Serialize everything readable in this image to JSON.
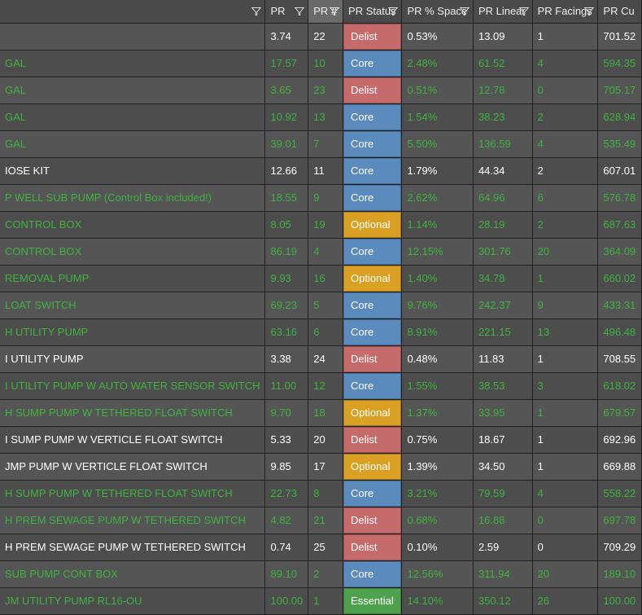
{
  "columns": [
    {
      "key": "name",
      "label": "",
      "width": "c0",
      "filter": true,
      "sorted": false
    },
    {
      "key": "pr",
      "label": "PR",
      "width": "c1",
      "filter": true,
      "sorted": false
    },
    {
      "key": "prnum",
      "label": "PR #",
      "width": "c2",
      "filter": true,
      "sorted": true
    },
    {
      "key": "status",
      "label": "PR Status",
      "width": "c3",
      "filter": true,
      "sorted": false
    },
    {
      "key": "pct",
      "label": "PR % Space",
      "width": "c4",
      "filter": true,
      "sorted": false
    },
    {
      "key": "linear",
      "label": "PR Linear",
      "width": "c5",
      "filter": true,
      "sorted": false
    },
    {
      "key": "facings",
      "label": "PR Facings",
      "width": "c6",
      "filter": true,
      "sorted": false
    },
    {
      "key": "cu",
      "label": "PR Cu",
      "width": "c7",
      "filter": false,
      "sorted": false
    }
  ],
  "status_colors": {
    "Delist": "#c66b6b",
    "Core": "#5b8bbd",
    "Optional": "#d9a023",
    "Essential": "#4ea24e"
  },
  "rows": [
    {
      "name": "",
      "pr": "3.74",
      "prnum": "22",
      "status": "Delist",
      "pct": "0.53%",
      "linear": "13.09",
      "facings": "1",
      "cu": "701.52",
      "cls": "white"
    },
    {
      "name": " GAL",
      "pr": "17.57",
      "prnum": "10",
      "status": "Core",
      "pct": "2.48%",
      "linear": "61.52",
      "facings": "4",
      "cu": "594.35",
      "cls": "green"
    },
    {
      "name": "GAL",
      "pr": "3.65",
      "prnum": "23",
      "status": "Delist",
      "pct": "0.51%",
      "linear": "12.78",
      "facings": "0",
      "cu": "705.17",
      "cls": "green"
    },
    {
      "name": "GAL",
      "pr": "10.92",
      "prnum": "13",
      "status": "Core",
      "pct": "1.54%",
      "linear": "38.23",
      "facings": "2",
      "cu": "628.94",
      "cls": "green"
    },
    {
      "name": "GAL",
      "pr": "39.01",
      "prnum": "7",
      "status": "Core",
      "pct": "5.50%",
      "linear": "136.59",
      "facings": "4",
      "cu": "535.49",
      "cls": "green"
    },
    {
      "name": "IOSE KIT",
      "pr": "12.66",
      "prnum": "11",
      "status": "Core",
      "pct": "1.79%",
      "linear": "44.34",
      "facings": "2",
      "cu": "607.01",
      "cls": "white"
    },
    {
      "name": "P WELL SUB PUMP  (Control Box included!)",
      "pr": "18.55",
      "prnum": "9",
      "status": "Core",
      "pct": "2.62%",
      "linear": "64.96",
      "facings": "6",
      "cu": "576.78",
      "cls": "green"
    },
    {
      "name": "CONTROL BOX",
      "pr": "8.05",
      "prnum": "19",
      "status": "Optional",
      "pct": "1.14%",
      "linear": "28.19",
      "facings": "2",
      "cu": "687.63",
      "cls": "green"
    },
    {
      "name": "CONTROL BOX",
      "pr": "86.19",
      "prnum": "4",
      "status": "Core",
      "pct": "12.15%",
      "linear": "301.76",
      "facings": "20",
      "cu": "364.09",
      "cls": "green"
    },
    {
      "name": "REMOVAL PUMP",
      "pr": "9.93",
      "prnum": "16",
      "status": "Optional",
      "pct": "1.40%",
      "linear": "34.78",
      "facings": "1",
      "cu": "660.02",
      "cls": "green"
    },
    {
      "name": "LOAT SWITCH",
      "pr": "69.23",
      "prnum": "5",
      "status": "Core",
      "pct": "9.76%",
      "linear": "242.37",
      "facings": "9",
      "cu": "433.31",
      "cls": "green"
    },
    {
      "name": "H UTILITY PUMP",
      "pr": "63.16",
      "prnum": "6",
      "status": "Core",
      "pct": "8.91%",
      "linear": "221.15",
      "facings": "13",
      "cu": "496.48",
      "cls": "green"
    },
    {
      "name": "I UTILITY PUMP",
      "pr": "3.38",
      "prnum": "24",
      "status": "Delist",
      "pct": "0.48%",
      "linear": "11.83",
      "facings": "1",
      "cu": "708.55",
      "cls": "white"
    },
    {
      "name": "I UTILITY PUMP W AUTO WATER SENSOR SWITCH",
      "pr": "11.00",
      "prnum": "12",
      "status": "Core",
      "pct": "1.55%",
      "linear": "38.53",
      "facings": "3",
      "cu": "618.02",
      "cls": "green"
    },
    {
      "name": "H SUMP PUMP W TETHERED FLOAT SWITCH",
      "pr": "9.70",
      "prnum": "18",
      "status": "Optional",
      "pct": "1.37%",
      "linear": "33.95",
      "facings": "1",
      "cu": "679.57",
      "cls": "green"
    },
    {
      "name": "I SUMP PUMP W VERTICLE FLOAT SWITCH",
      "pr": "5.33",
      "prnum": "20",
      "status": "Delist",
      "pct": "0.75%",
      "linear": "18.67",
      "facings": "1",
      "cu": "692.96",
      "cls": "white"
    },
    {
      "name": "JMP PUMP W VERTICLE FLOAT SWITCH",
      "pr": "9.85",
      "prnum": "17",
      "status": "Optional",
      "pct": "1.39%",
      "linear": "34.50",
      "facings": "1",
      "cu": "669.88",
      "cls": "white"
    },
    {
      "name": "H SUMP PUMP W TETHERED FLOAT SWITCH",
      "pr": "22.73",
      "prnum": "8",
      "status": "Core",
      "pct": "3.21%",
      "linear": "79.59",
      "facings": "4",
      "cu": "558.22",
      "cls": "green"
    },
    {
      "name": "H PREM SEWAGE PUMP W TETHERED SWITCH",
      "pr": "4.82",
      "prnum": "21",
      "status": "Delist",
      "pct": "0.68%",
      "linear": "16.88",
      "facings": "0",
      "cu": "697.78",
      "cls": "green"
    },
    {
      "name": "H PREM SEWAGE PUMP W TETHERED SWITCH",
      "pr": "0.74",
      "prnum": "25",
      "status": "Delist",
      "pct": "0.10%",
      "linear": "2.59",
      "facings": "0",
      "cu": "709.29",
      "cls": "white"
    },
    {
      "name": "SUB PUMP CONT BOX",
      "pr": "89.10",
      "prnum": "2",
      "status": "Core",
      "pct": "12.56%",
      "linear": "311.94",
      "facings": "20",
      "cu": "189.10",
      "cls": "green"
    },
    {
      "name": "JM UTILITY PUMP RL16-OU",
      "pr": "100.00",
      "prnum": "1",
      "status": "Essential",
      "pct": "14.10%",
      "linear": "350.12",
      "facings": "26",
      "cu": "100.00",
      "cls": "green"
    }
  ]
}
